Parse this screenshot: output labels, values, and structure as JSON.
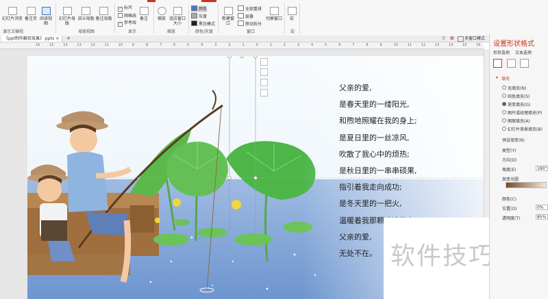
{
  "ribbon": {
    "buttons": [
      {
        "label": "幻灯片浏览"
      },
      {
        "label": "备注页"
      },
      {
        "label": "阅读视图"
      },
      {
        "label": "幻灯片母版"
      },
      {
        "label": "讲义母版"
      },
      {
        "label": "备注母版"
      },
      {
        "label": "备注"
      },
      {
        "label": "缩放"
      },
      {
        "label": "适应窗口大小"
      },
      {
        "label": "新建窗口"
      },
      {
        "label": "切换窗口"
      },
      {
        "label": "宏"
      }
    ],
    "checkboxes": [
      {
        "label": "标尺",
        "checked": true
      },
      {
        "label": "网格线",
        "checked": false
      },
      {
        "label": "参考线",
        "checked": true
      }
    ],
    "color_options": [
      "颜色",
      "灰度",
      "黑白模式"
    ],
    "window_options": [
      "全部重排",
      "层叠",
      "移动拆分"
    ],
    "groups": [
      "演示文稿视图",
      "母版视图",
      "显示",
      "缩放",
      "颜色/灰度",
      "窗口",
      "宏"
    ]
  },
  "tabbar": {
    "doc_tab": "《ppt制作翻页效果》.pptx ×",
    "add": "+",
    "view_mode": "多窗口模式"
  },
  "ruler": {
    "ticks": [
      "16",
      "15",
      "14",
      "13",
      "12",
      "11",
      "10",
      "9",
      "8",
      "7",
      "6",
      "5",
      "4",
      "3",
      "2",
      "1",
      "0",
      "1",
      "2",
      "3",
      "4",
      "5",
      "6",
      "7",
      "8",
      "9",
      "10",
      "11",
      "12",
      "13",
      "14",
      "15",
      "16"
    ]
  },
  "slide": {
    "poem": [
      "父亲的爱,",
      "是春天里的一缕阳光,",
      "和煦地照耀在我的身上;",
      "是夏日里的一丝凉风,",
      "吹散了我心中的烦热;",
      "是秋日里的一串串硕果,",
      "指引着我走向成功;",
      "是冬天里的一把火,",
      "温暖着我那颗冰冷的心;",
      "父亲的爱,",
      "无处不在。"
    ],
    "watermark": "软件技巧"
  },
  "format_pane": {
    "title": "设置形状格式",
    "tabs": [
      "形状选项",
      "文本选项"
    ],
    "section": "填充",
    "fill_options": [
      {
        "label": "无填充(N)",
        "selected": false
      },
      {
        "label": "纯色填充(S)",
        "selected": false
      },
      {
        "label": "渐变填充(G)",
        "selected": true
      },
      {
        "label": "图片或纹理填充(P)",
        "selected": false
      },
      {
        "label": "图案填充(A)",
        "selected": false
      },
      {
        "label": "幻灯片背景填充(B)",
        "selected": false
      }
    ],
    "fields": {
      "preset": "预设渐变(R)",
      "type": "类型(Y)",
      "direction": "方向(D)",
      "angle_label": "角度(E)",
      "angle_value": "180°",
      "stops": "渐变光圈",
      "color": "颜色(C)",
      "position_label": "位置(O)",
      "position_value": "0%",
      "transparency_label": "透明度(T)",
      "transparency_value": "85%"
    }
  },
  "colors": {
    "accent": "#c3361f",
    "sky": "#eef6fb",
    "water": "#7fa6d8",
    "leaf": "#4db648"
  }
}
